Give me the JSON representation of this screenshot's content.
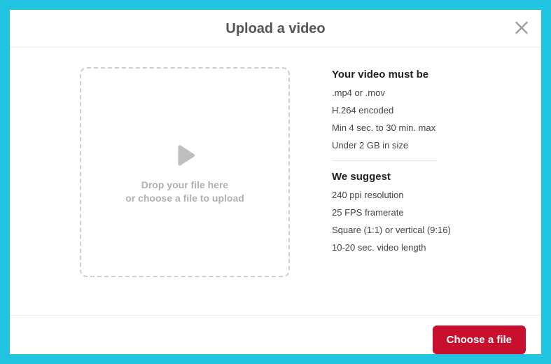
{
  "modal": {
    "title": "Upload a video"
  },
  "dropzone": {
    "line1": "Drop your file here",
    "line2": "or choose a file to upload"
  },
  "requirements": {
    "title": "Your video must be",
    "items": [
      ".mp4 or .mov",
      "H.264 encoded",
      "Min 4 sec. to 30 min. max",
      "Under 2 GB in size"
    ]
  },
  "suggestions": {
    "title": "We suggest",
    "items": [
      "240 ppi resolution",
      "25 FPS framerate",
      "Square (1:1) or vertical (9:16)",
      "10-20 sec. video length"
    ]
  },
  "footer": {
    "choose_file_label": "Choose a file"
  },
  "colors": {
    "frame_bg": "#20c4e0",
    "primary_button": "#c8102e"
  }
}
